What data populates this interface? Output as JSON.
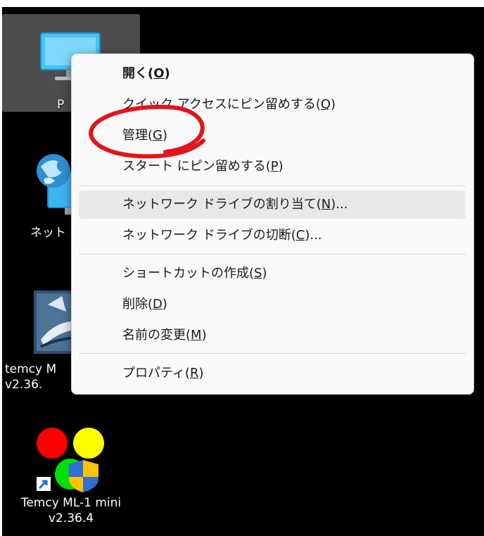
{
  "desktop": {
    "icons": [
      {
        "label": "P",
        "icon": "monitor-icon"
      },
      {
        "label": "ネット",
        "icon": "network-globe-icon"
      },
      {
        "label": "temcy M\nv2.36.",
        "icon": "temcy-app-icon"
      },
      {
        "label": "Temcy ML-1 mini\nv2.36.4",
        "icon": "temcy-mini-shortcut-icon"
      }
    ]
  },
  "context_menu": {
    "items": [
      {
        "label": "開く(",
        "mn": "O",
        "tail": ")",
        "bold": true
      },
      {
        "label": "クイック アクセスにピン留めする(",
        "mn": "Q",
        "tail": ")"
      },
      {
        "label": "管理(",
        "mn": "G",
        "tail": ")"
      },
      {
        "label": "スタート にピン留めする(",
        "mn": "P",
        "tail": ")"
      },
      {
        "label": "ネットワーク ドライブの割り当て(",
        "mn": "N",
        "tail": ")..."
      },
      {
        "label": "ネットワーク ドライブの切断(",
        "mn": "C",
        "tail": ")..."
      },
      {
        "label": "ショートカットの作成(",
        "mn": "S",
        "tail": ")"
      },
      {
        "label": "削除(",
        "mn": "D",
        "tail": ")"
      },
      {
        "label": "名前の変更(",
        "mn": "M",
        "tail": ")"
      },
      {
        "label": "プロパティ(",
        "mn": "R",
        "tail": ")"
      }
    ],
    "hovered_item": "ネットワーク ドライブの割り当て(N)..."
  },
  "colors": {
    "desktop_bg": "#000000",
    "menu_bg": "#f9f9f9",
    "annotation_red": "#e3141b",
    "hover_bg": "#e8e8e8"
  }
}
